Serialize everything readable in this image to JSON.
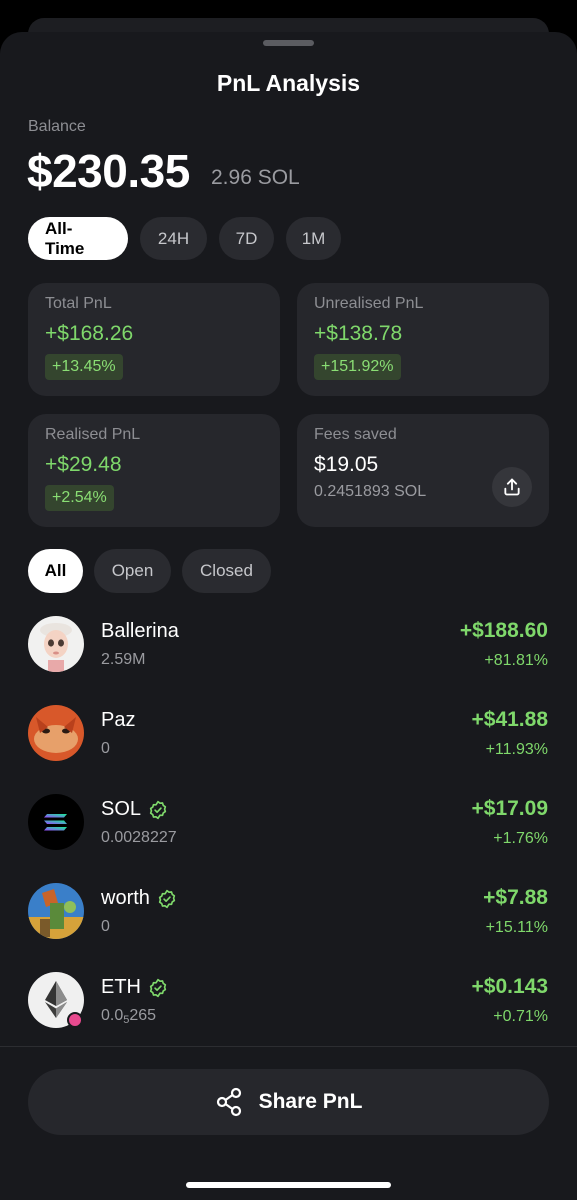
{
  "header": {
    "title": "PnL Analysis"
  },
  "balance": {
    "label": "Balance",
    "value": "$230.35",
    "sol": "2.96 SOL"
  },
  "timeframes": [
    {
      "label": "All-Time",
      "active": true
    },
    {
      "label": "24H",
      "active": false
    },
    {
      "label": "7D",
      "active": false
    },
    {
      "label": "1M",
      "active": false
    }
  ],
  "cards": {
    "total": {
      "label": "Total PnL",
      "value": "+$168.26",
      "pct": "+13.45%"
    },
    "unrealised": {
      "label": "Unrealised PnL",
      "value": "+$138.78",
      "pct": "+151.92%"
    },
    "realised": {
      "label": "Realised PnL",
      "value": "+$29.48",
      "pct": "+2.54%"
    },
    "fees": {
      "label": "Fees saved",
      "value": "$19.05",
      "sol": "0.2451893 SOL"
    }
  },
  "filters": [
    {
      "label": "All",
      "active": true
    },
    {
      "label": "Open",
      "active": false
    },
    {
      "label": "Closed",
      "active": false
    }
  ],
  "tokens": [
    {
      "name": "Ballerina",
      "amount": "2.59M",
      "pnl": "+$188.60",
      "pct": "+81.81%",
      "verified": false
    },
    {
      "name": "Paz",
      "amount": "0",
      "pnl": "+$41.88",
      "pct": "+11.93%",
      "verified": false
    },
    {
      "name": "SOL",
      "amount": "0.0028227",
      "pnl": "+$17.09",
      "pct": "+1.76%",
      "verified": true
    },
    {
      "name": "worth",
      "amount": "0",
      "pnl": "+$7.88",
      "pct": "+15.11%",
      "verified": true
    },
    {
      "name": "ETH",
      "amount_prefix": "0.0",
      "amount_sub": "5",
      "amount_suffix": "265",
      "pnl": "+$0.143",
      "pct": "+0.71%",
      "verified": true
    }
  ],
  "share_button": {
    "label": "Share PnL"
  },
  "colors": {
    "positive": "#7fd86b",
    "background": "#18191d",
    "card": "#26272c",
    "verified": "#7fd86b"
  },
  "icons": {
    "verified": "verified-badge-icon",
    "share": "share-nodes-icon",
    "upload": "upload-icon"
  }
}
